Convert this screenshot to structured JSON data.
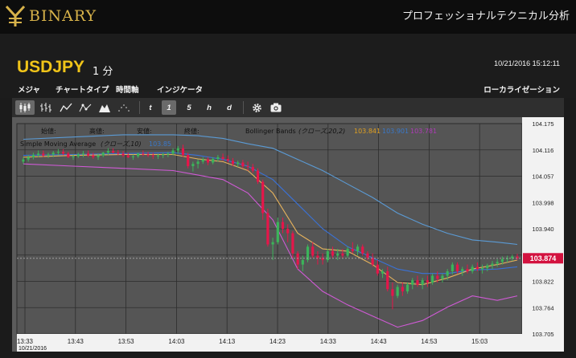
{
  "brand": {
    "name": "BINARY",
    "tagline": "プロフェッショナルテクニカル分析"
  },
  "header": {
    "symbol": "USDJPY",
    "interval": "1 分",
    "datetime": "10/21/2016 15:12:11"
  },
  "menu": {
    "items": [
      "メジャ",
      "チャートタイプ",
      "時間軸",
      "インジケータ"
    ],
    "right": "ローカライゼーション"
  },
  "toolbar": {
    "chart_types": [
      "candlestick-icon",
      "ohlc-icon",
      "line-icon",
      "dot-line-icon",
      "area-icon",
      "dot-icon"
    ],
    "timeframes": [
      "t",
      "1",
      "5",
      "h",
      "d"
    ],
    "active_timeframe": "1",
    "actions": [
      "gear-icon",
      "camera-icon"
    ]
  },
  "colors": {
    "bg": "#1b1b1b",
    "plot_bg": "#5b5b5b",
    "accent": "#f0c419",
    "up": "#3bb55a",
    "down": "#e5164a",
    "bb_upper": "#5b9bd5",
    "bb_lower": "#d05ad6",
    "sma": "#e6b25c"
  },
  "legend": {
    "ohlc_labels": [
      "始値:",
      "高値:",
      "安値:",
      "終値:"
    ],
    "bb_label": "Bollinger Bands",
    "bb_params": "(クローズ,20,2)",
    "bb_values": [
      "103.841",
      "103.901",
      "103.781"
    ],
    "sma_label": "Simple Moving Average",
    "sma_params": "(クローズ,10)",
    "sma_value": "103.85"
  },
  "chart_data": {
    "type": "line",
    "title": "",
    "xlabel": "",
    "ylabel": "",
    "x_ticks": [
      "13:33",
      "13:43",
      "13:53",
      "14:03",
      "14:13",
      "14:23",
      "14:33",
      "14:43",
      "14:53",
      "15:03"
    ],
    "x_date_label": "10/21/2016",
    "y_ticks": [
      "104.175",
      "104.116",
      "104.057",
      "103.998",
      "103.940",
      "103.881",
      "103.822",
      "103.764",
      "103.705"
    ],
    "ylim": [
      103.705,
      104.175
    ],
    "xlim": [
      0,
      99
    ],
    "last_price": "103.874",
    "candles": [
      [
        104.09,
        104.1,
        104.085,
        104.095
      ],
      [
        104.095,
        104.105,
        104.09,
        104.1
      ],
      [
        104.1,
        104.11,
        104.095,
        104.105
      ],
      [
        104.105,
        104.115,
        104.1,
        104.108
      ],
      [
        104.108,
        104.115,
        104.1,
        104.104
      ],
      [
        104.104,
        104.11,
        104.098,
        104.106
      ],
      [
        104.106,
        104.114,
        104.1,
        104.11
      ],
      [
        104.11,
        104.118,
        104.104,
        104.112
      ],
      [
        104.112,
        104.118,
        104.104,
        104.108
      ],
      [
        104.108,
        104.112,
        104.098,
        104.1
      ],
      [
        104.1,
        104.106,
        104.094,
        104.102
      ],
      [
        104.102,
        104.11,
        104.098,
        104.106
      ],
      [
        104.106,
        104.114,
        104.1,
        104.108
      ],
      [
        104.108,
        104.115,
        104.1,
        104.104
      ],
      [
        104.104,
        104.11,
        104.096,
        104.1
      ],
      [
        104.1,
        104.108,
        104.094,
        104.104
      ],
      [
        104.104,
        104.112,
        104.1,
        104.11
      ],
      [
        104.11,
        104.12,
        104.105,
        104.114
      ],
      [
        104.114,
        104.12,
        104.108,
        104.11
      ],
      [
        104.11,
        104.116,
        104.104,
        104.108
      ],
      [
        104.108,
        104.114,
        104.1,
        104.104
      ],
      [
        104.104,
        104.11,
        104.098,
        104.1
      ],
      [
        104.1,
        104.106,
        104.094,
        104.102
      ],
      [
        104.102,
        104.11,
        104.098,
        104.108
      ],
      [
        104.108,
        104.115,
        104.102,
        104.106
      ],
      [
        104.106,
        104.112,
        104.1,
        104.104
      ],
      [
        104.104,
        104.11,
        104.096,
        104.102
      ],
      [
        104.102,
        104.108,
        104.096,
        104.104
      ],
      [
        104.104,
        104.11,
        104.098,
        104.106
      ],
      [
        104.106,
        104.112,
        104.1,
        104.108
      ],
      [
        104.108,
        104.12,
        104.104,
        104.115
      ],
      [
        104.115,
        104.125,
        104.108,
        104.12
      ],
      [
        104.12,
        104.128,
        104.1,
        104.105
      ],
      [
        104.105,
        104.11,
        104.075,
        104.08
      ],
      [
        104.08,
        104.09,
        104.068,
        104.085
      ],
      [
        104.085,
        104.095,
        104.075,
        104.09
      ],
      [
        104.09,
        104.1,
        104.085,
        104.095
      ],
      [
        104.095,
        104.1,
        104.082,
        104.088
      ],
      [
        104.088,
        104.1,
        104.084,
        104.096
      ],
      [
        104.096,
        104.105,
        104.09,
        104.1
      ],
      [
        104.1,
        104.108,
        104.092,
        104.096
      ],
      [
        104.096,
        104.104,
        104.088,
        104.092
      ],
      [
        104.092,
        104.098,
        104.08,
        104.085
      ],
      [
        104.085,
        104.092,
        104.078,
        104.088
      ],
      [
        104.088,
        104.094,
        104.075,
        104.08
      ],
      [
        104.08,
        104.09,
        104.07,
        104.078
      ],
      [
        104.078,
        104.085,
        104.065,
        104.07
      ],
      [
        104.07,
        104.075,
        104.04,
        104.045
      ],
      [
        104.045,
        104.05,
        103.96,
        103.975
      ],
      [
        103.975,
        103.985,
        103.9,
        103.905
      ],
      [
        103.905,
        103.92,
        103.87,
        103.91
      ],
      [
        103.91,
        103.965,
        103.905,
        103.955
      ],
      [
        103.955,
        103.965,
        103.93,
        103.94
      ],
      [
        103.94,
        103.95,
        103.91,
        103.93
      ],
      [
        103.93,
        103.935,
        103.875,
        103.885
      ],
      [
        103.885,
        103.89,
        103.85,
        103.86
      ],
      [
        103.86,
        103.88,
        103.845,
        103.87
      ],
      [
        103.87,
        103.905,
        103.865,
        103.9
      ],
      [
        103.9,
        103.91,
        103.875,
        103.88
      ],
      [
        103.88,
        103.89,
        103.86,
        103.875
      ],
      [
        103.875,
        103.885,
        103.86,
        103.87
      ],
      [
        103.87,
        103.895,
        103.865,
        103.89
      ],
      [
        103.89,
        103.9,
        103.875,
        103.88
      ],
      [
        103.88,
        103.895,
        103.87,
        103.885
      ],
      [
        103.885,
        103.895,
        103.875,
        103.88
      ],
      [
        103.88,
        103.9,
        103.875,
        103.895
      ],
      [
        103.895,
        103.91,
        103.885,
        103.89
      ],
      [
        103.89,
        103.905,
        103.88,
        103.9
      ],
      [
        103.9,
        103.905,
        103.88,
        103.885
      ],
      [
        103.885,
        103.89,
        103.87,
        103.875
      ],
      [
        103.875,
        103.885,
        103.855,
        103.86
      ],
      [
        103.86,
        103.87,
        103.835,
        103.84
      ],
      [
        103.84,
        103.85,
        103.83,
        103.845
      ],
      [
        103.845,
        103.855,
        103.8,
        103.805
      ],
      [
        103.805,
        103.82,
        103.76,
        103.79
      ],
      [
        103.79,
        103.815,
        103.785,
        103.81
      ],
      [
        103.81,
        103.82,
        103.79,
        103.8
      ],
      [
        103.8,
        103.82,
        103.795,
        103.815
      ],
      [
        103.815,
        103.83,
        103.805,
        103.825
      ],
      [
        103.825,
        103.835,
        103.81,
        103.815
      ],
      [
        103.815,
        103.83,
        103.805,
        103.825
      ],
      [
        103.825,
        103.835,
        103.81,
        103.82
      ],
      [
        103.82,
        103.84,
        103.815,
        103.835
      ],
      [
        103.835,
        103.845,
        103.82,
        103.828
      ],
      [
        103.828,
        103.84,
        103.82,
        103.835
      ],
      [
        103.835,
        103.85,
        103.825,
        103.845
      ],
      [
        103.845,
        103.865,
        103.838,
        103.86
      ],
      [
        103.86,
        103.865,
        103.84,
        103.845
      ],
      [
        103.845,
        103.855,
        103.835,
        103.85
      ],
      [
        103.85,
        103.86,
        103.84,
        103.845
      ],
      [
        103.845,
        103.86,
        103.84,
        103.855
      ],
      [
        103.855,
        103.865,
        103.845,
        103.85
      ],
      [
        103.85,
        103.86,
        103.84,
        103.852
      ],
      [
        103.852,
        103.862,
        103.845,
        103.858
      ],
      [
        103.858,
        103.868,
        103.85,
        103.862
      ],
      [
        103.862,
        103.872,
        103.855,
        103.866
      ],
      [
        103.866,
        103.878,
        103.86,
        103.872
      ],
      [
        103.872,
        103.88,
        103.865,
        103.874
      ],
      [
        103.874,
        103.882,
        103.868,
        103.878
      ],
      [
        103.878,
        103.884,
        103.87,
        103.874
      ]
    ],
    "series": [
      {
        "name": "Bollinger Bands upper",
        "x": [
          0,
          10,
          20,
          30,
          35,
          40,
          45,
          50,
          55,
          60,
          65,
          70,
          75,
          80,
          85,
          90,
          95,
          99
        ],
        "values": [
          104.14,
          104.145,
          104.15,
          104.15,
          104.148,
          104.142,
          104.13,
          104.12,
          104.095,
          104.07,
          104.04,
          104.01,
          103.975,
          103.95,
          103.93,
          103.915,
          103.91,
          103.905
        ]
      },
      {
        "name": "Bollinger Bands lower",
        "x": [
          0,
          10,
          20,
          30,
          35,
          40,
          45,
          50,
          55,
          60,
          65,
          70,
          75,
          80,
          85,
          90,
          95,
          99
        ],
        "values": [
          104.085,
          104.08,
          104.075,
          104.07,
          104.06,
          104.05,
          104.02,
          103.96,
          103.85,
          103.8,
          103.77,
          103.745,
          103.72,
          103.735,
          103.765,
          103.79,
          103.78,
          103.79
        ]
      },
      {
        "name": "Bollinger Bands middle",
        "x": [
          0,
          10,
          20,
          30,
          35,
          40,
          45,
          50,
          55,
          60,
          65,
          70,
          75,
          80,
          85,
          90,
          95,
          99
        ],
        "values": [
          104.104,
          104.106,
          104.108,
          104.11,
          104.104,
          104.095,
          104.08,
          104.05,
          103.995,
          103.94,
          103.9,
          103.875,
          103.85,
          103.84,
          103.84,
          103.848,
          103.85,
          103.855
        ]
      },
      {
        "name": "Simple Moving Average",
        "x": [
          0,
          10,
          20,
          30,
          35,
          40,
          45,
          50,
          55,
          60,
          65,
          70,
          75,
          80,
          85,
          90,
          95,
          99
        ],
        "values": [
          104.1,
          104.104,
          104.106,
          104.106,
          104.096,
          104.09,
          104.07,
          104.02,
          103.93,
          103.895,
          103.89,
          103.86,
          103.82,
          103.815,
          103.83,
          103.85,
          103.86,
          103.87
        ]
      }
    ]
  }
}
